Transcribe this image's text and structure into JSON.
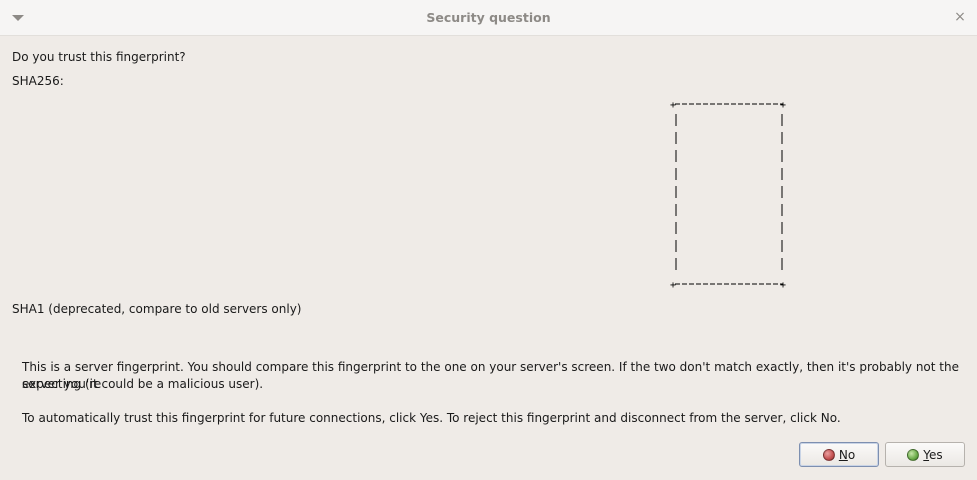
{
  "window": {
    "title": "Security question",
    "menu_icon": "chevron-down-icon",
    "close_icon": "close-icon",
    "close_glyph": "×"
  },
  "question": "Do you trust this fingerprint?",
  "sha256_label": "SHA256:",
  "sha1_label": "SHA1 (deprecated, compare to old servers only)",
  "info": {
    "line1": "This is a server fingerprint. You should compare this fingerprint to the one on your server's screen. If the two don't match exactly, then it's probably not the server you're",
    "line2": "expecting (it could be a malicious user).",
    "line3": "To automatically trust this fingerprint for future connections, click Yes. To reject this fingerprint and disconnect from the server, click No."
  },
  "buttons": {
    "no": {
      "mnemonic": "N",
      "rest": "o",
      "icon": "red-dot-icon",
      "color": "#c45050"
    },
    "yes": {
      "mnemonic": "Y",
      "rest": "es",
      "icon": "green-dot-icon",
      "color": "#6aab48"
    }
  }
}
